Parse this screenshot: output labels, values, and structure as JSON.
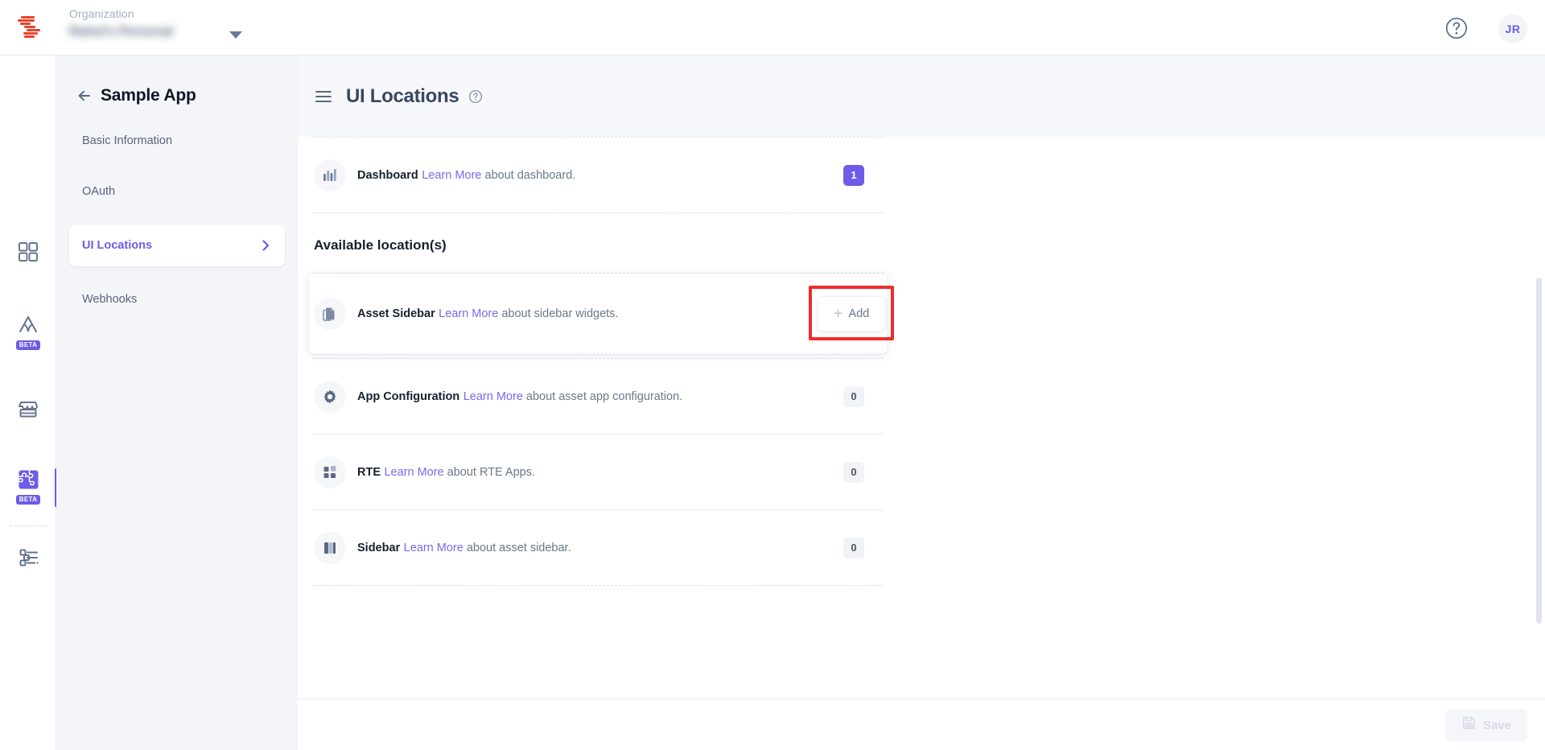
{
  "topbar": {
    "org_label": "Organization",
    "org_name": "Rahul's Personal",
    "logo_icon": "contentstack-logo-icon",
    "caret_icon": "chevron-down-icon",
    "help_icon": "help-circle-icon",
    "avatar_initials": "JR"
  },
  "rail": {
    "items": [
      {
        "icon": "grid-apps-icon",
        "badge": ""
      },
      {
        "icon": "mountain-peak-icon",
        "badge": "BETA"
      },
      {
        "icon": "marketplace-storefront-icon",
        "badge": ""
      },
      {
        "icon": "puzzle-piece-icon",
        "badge": "BETA"
      },
      {
        "icon": "sliders-settings-icon",
        "badge": ""
      }
    ]
  },
  "app_sidebar": {
    "back_icon": "arrow-left-icon",
    "title": "Sample App",
    "items": [
      {
        "label": "Basic Information",
        "active": false
      },
      {
        "label": "OAuth",
        "active": false
      },
      {
        "label": "UI Locations",
        "active": true
      },
      {
        "label": "Webhooks",
        "active": false
      }
    ],
    "chevron_icon": "chevron-right-icon"
  },
  "main": {
    "menu_icon": "hamburger-menu-icon",
    "title": "UI Locations",
    "title_help_icon": "help-circle-icon",
    "configured_rows": [
      {
        "icon": "bar-chart-icon",
        "name": "Dashboard",
        "link_text": "Learn More",
        "desc_rest": " about dashboard.",
        "badge": "1",
        "badge_style": "purple"
      }
    ],
    "section_title": "Available location(s)",
    "available_rows": [
      {
        "icon": "document-copy-icon",
        "name": "Asset Sidebar",
        "link_text": "Learn More",
        "desc_rest": " about sidebar widgets.",
        "action": "add",
        "add_label": "Add",
        "add_icon": "plus-icon",
        "highlighted": true
      },
      {
        "icon": "gear-icon",
        "name": "App Configuration",
        "link_text": "Learn More",
        "desc_rest": " about asset app configuration.",
        "badge": "0",
        "badge_style": "gray"
      },
      {
        "icon": "rte-blocks-icon",
        "name": "RTE",
        "link_text": "Learn More",
        "desc_rest": " about RTE Apps.",
        "badge": "0",
        "badge_style": "gray"
      },
      {
        "icon": "sidebar-panel-icon",
        "name": "Sidebar",
        "link_text": "Learn More",
        "desc_rest": " about asset sidebar.",
        "badge": "0",
        "badge_style": "gray"
      }
    ]
  },
  "footer": {
    "save_label": "Save",
    "save_icon": "floppy-disk-icon",
    "save_disabled": true
  },
  "colors": {
    "accent_purple": "#6c5ce7",
    "link_purple": "#7b68ee",
    "badge_gray_bg": "#f1f3f8",
    "annotation_red": "#f02c2c",
    "sidebar_bg": "#f4f5f9",
    "header_bg": "#f7f8fc"
  }
}
